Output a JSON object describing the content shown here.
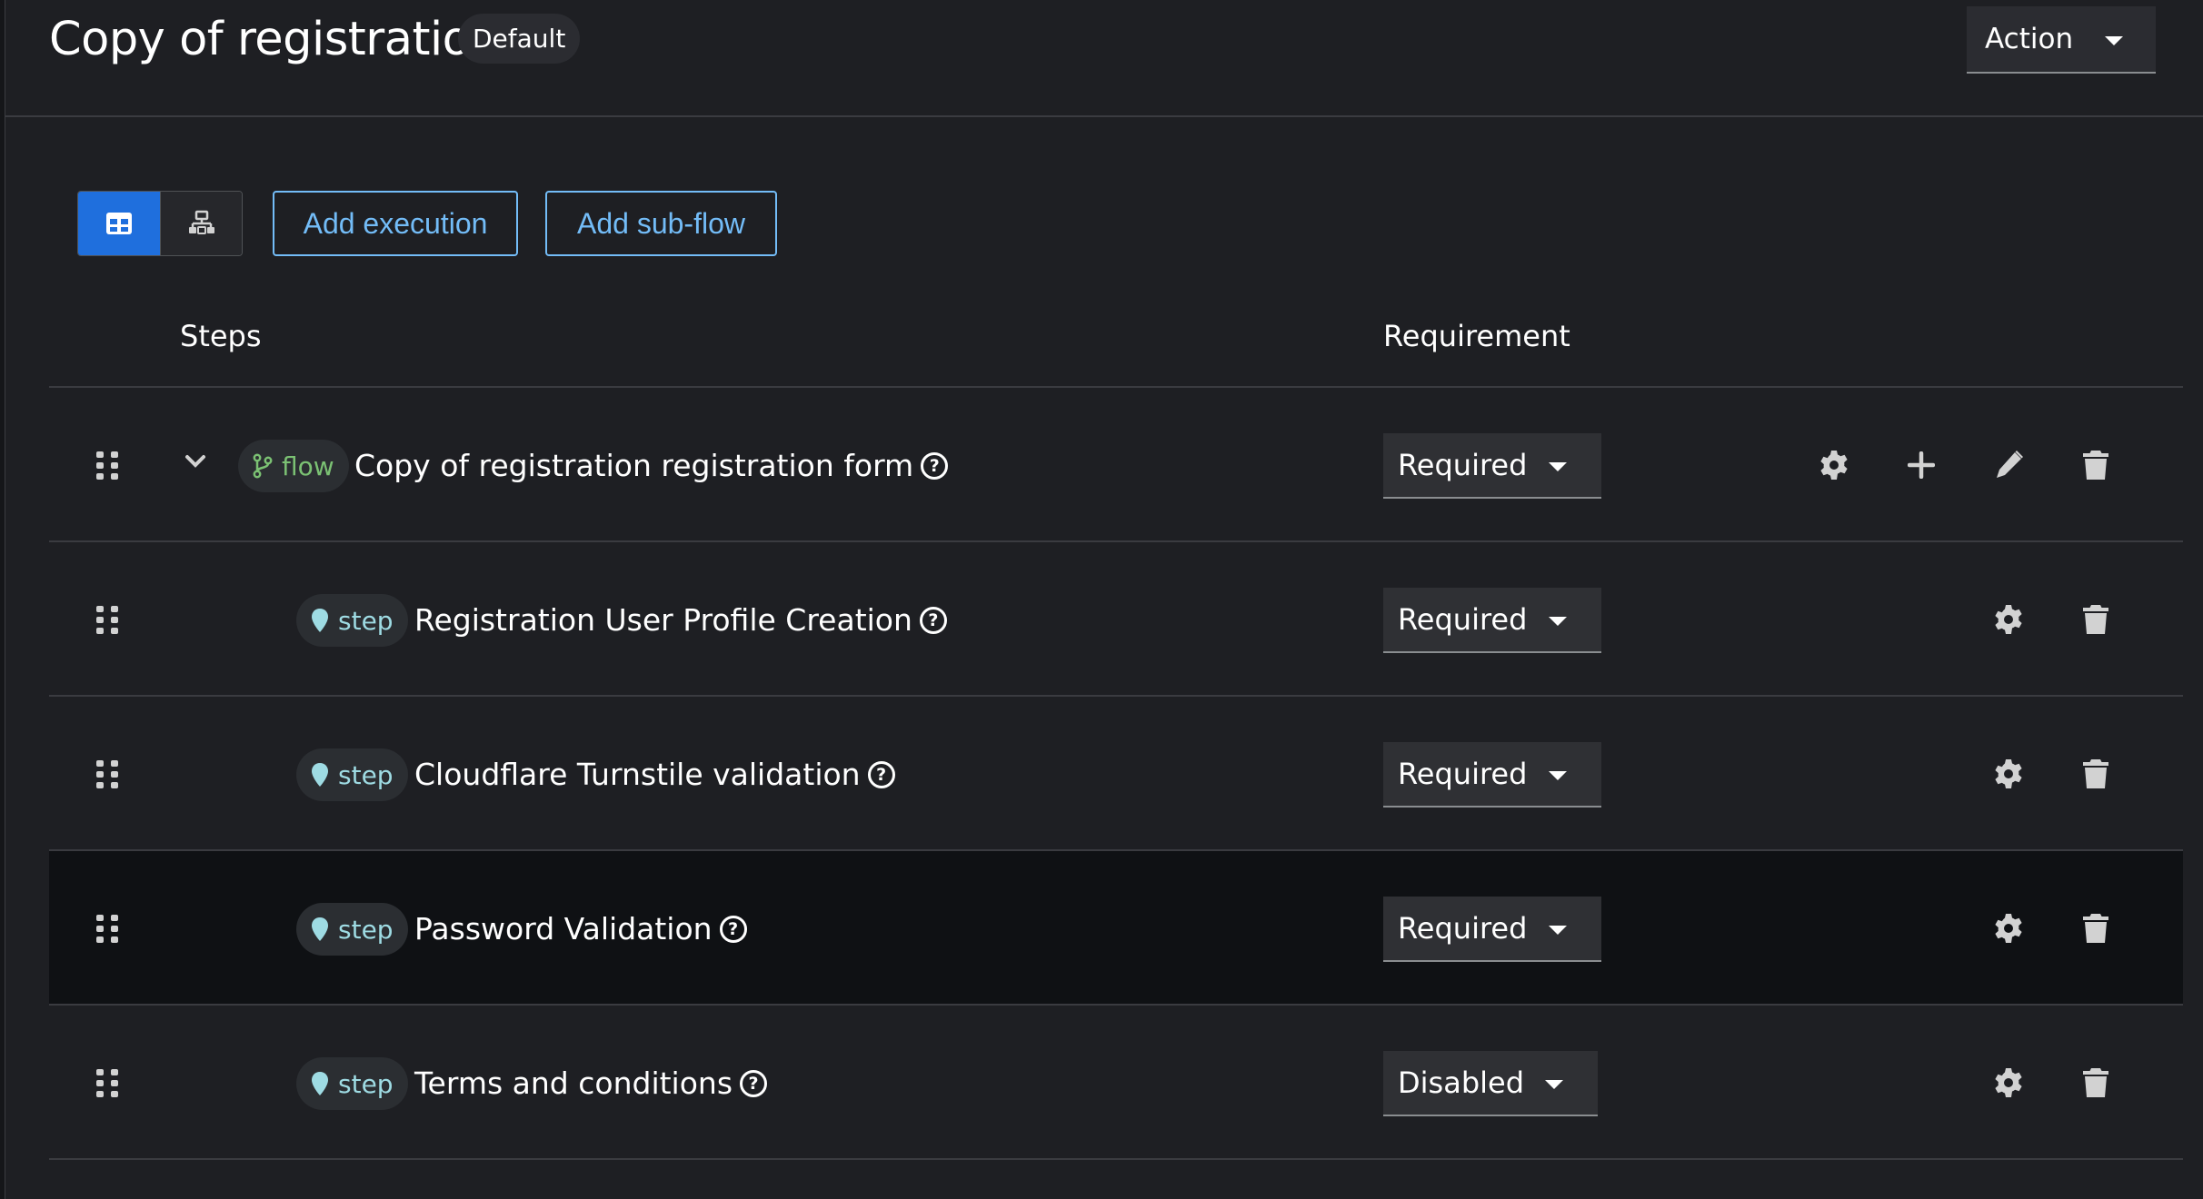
{
  "header": {
    "title": "Copy of registration",
    "badge": "Default",
    "action_label": "Action"
  },
  "toolbar": {
    "view_table": "table-view-icon",
    "view_diagram": "diagram-view-icon",
    "add_execution": "Add execution",
    "add_subflow": "Add sub-flow"
  },
  "table": {
    "columns": {
      "steps": "Steps",
      "requirement": "Requirement"
    },
    "rows": [
      {
        "type": "flow",
        "type_label": "flow",
        "name": "Copy of registration registration form",
        "requirement": "Required"
      },
      {
        "type": "step",
        "type_label": "step",
        "name": "Registration User Profile Creation",
        "requirement": "Required"
      },
      {
        "type": "step",
        "type_label": "step",
        "name": "Cloudflare Turnstile validation",
        "requirement": "Required"
      },
      {
        "type": "step",
        "type_label": "step",
        "name": "Password Validation",
        "requirement": "Required"
      },
      {
        "type": "step",
        "type_label": "step",
        "name": "Terms and conditions",
        "requirement": "Disabled"
      }
    ]
  },
  "colors": {
    "background": "#1e1f23",
    "accent_blue": "#73bcf7",
    "active_toggle": "#1f6fdd",
    "flow_green": "#7bc173",
    "step_teal": "#9edbe3",
    "highlight_row": "#0f1114"
  }
}
